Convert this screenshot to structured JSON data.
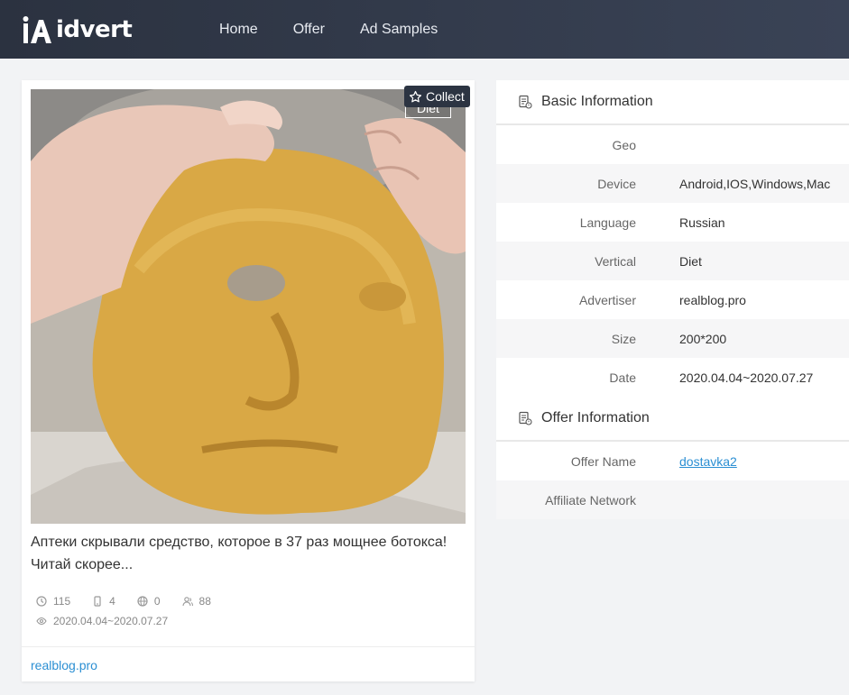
{
  "brand": {
    "logo_text": "idvert"
  },
  "nav": {
    "items": [
      {
        "label": "Home"
      },
      {
        "label": "Offer"
      },
      {
        "label": "Ad Samples"
      }
    ]
  },
  "ad": {
    "tag": "Diet",
    "collect_label": "Collect",
    "title": "Аптеки скрывали средство, которое в 37 раз мощнее ботокса! Читай скорее...",
    "stats": {
      "views": "115",
      "devices": "4",
      "geos": "0",
      "users": "88",
      "date_range": "2020.04.04~2020.07.27"
    },
    "domain": "realblog.pro"
  },
  "basic_info": {
    "title": "Basic Information",
    "rows": [
      {
        "key": "Geo",
        "value": ""
      },
      {
        "key": "Device",
        "value": "Android,IOS,Windows,Mac"
      },
      {
        "key": "Language",
        "value": "Russian"
      },
      {
        "key": "Vertical",
        "value": "Diet"
      },
      {
        "key": "Advertiser",
        "value": "realblog.pro"
      },
      {
        "key": "Size",
        "value": "200*200"
      },
      {
        "key": "Date",
        "value": "2020.04.04~2020.07.27"
      }
    ]
  },
  "offer_info": {
    "title": "Offer Information",
    "rows": [
      {
        "key": "Offer Name",
        "value": "dostavka2"
      },
      {
        "key": "Affiliate Network",
        "value": ""
      }
    ]
  },
  "colors": {
    "header_bg": "#2b3240",
    "link": "#2b8fd3",
    "page_bg": "#f2f3f5"
  }
}
